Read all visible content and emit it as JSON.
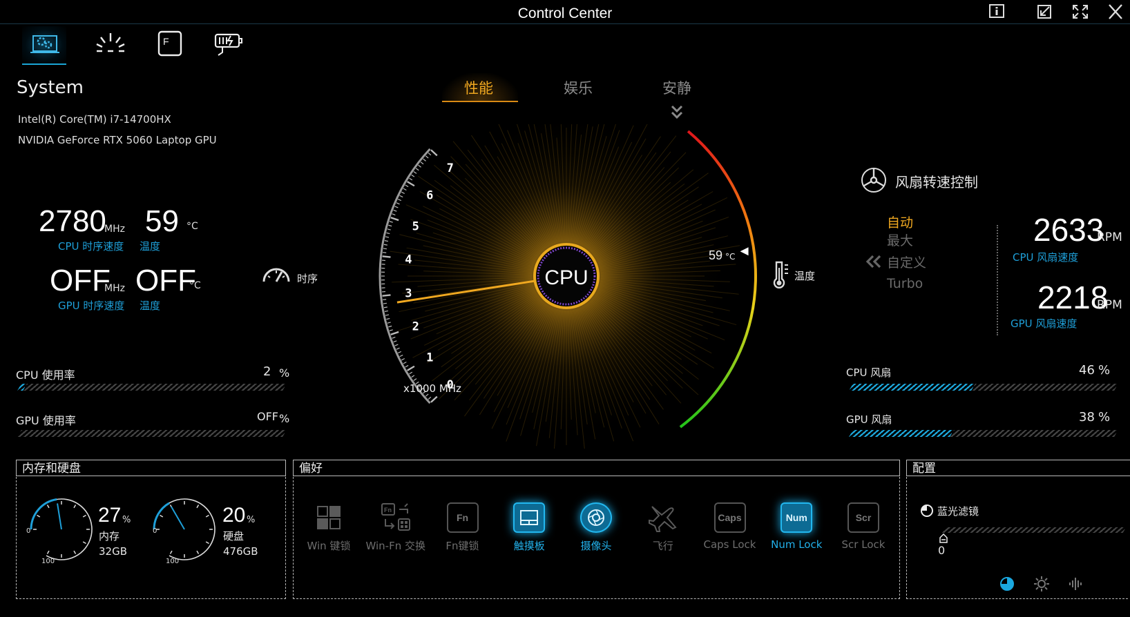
{
  "window": {
    "title": "Control Center"
  },
  "nav": {
    "tabs": [
      "system-settings",
      "lighting",
      "function-keys",
      "battery-power"
    ]
  },
  "system": {
    "heading": "System",
    "cpu_name": "Intel(R) Core(TM) i7-14700HX",
    "gpu_name": "NVIDIA GeForce RTX 5060 Laptop GPU",
    "cpu_clock": "2780",
    "cpu_clock_unit": "MHz",
    "cpu_clock_label": "CPU 时序速度",
    "cpu_temp": "59",
    "cpu_temp_unit": "°C",
    "cpu_temp_label": "温度",
    "gpu_clock": "OFF",
    "gpu_clock_unit": "MHz",
    "gpu_clock_label": "GPU 时序速度",
    "gpu_temp": "OFF",
    "gpu_temp_unit": "°C",
    "gpu_temp_label": "温度"
  },
  "usage": {
    "cpu_label": "CPU 使用率",
    "cpu_value": "2",
    "cpu_unit": "%",
    "cpu_percent": 2,
    "gpu_label": "GPU 使用率",
    "gpu_value": "OFF",
    "gpu_unit": "%",
    "gpu_percent": 0
  },
  "modes": {
    "items": [
      "性能",
      "娱乐",
      "安静"
    ],
    "selected": 0
  },
  "gauge": {
    "center_label": "CPU",
    "clock_side_label": "时序",
    "temp_side_label": "温度",
    "ticks": [
      "0",
      "1",
      "2",
      "3",
      "4",
      "5",
      "6",
      "7"
    ],
    "unit_label": "x1000 MHz",
    "clock_value_khz": 2.78,
    "temp_readout": "59",
    "temp_unit": "°C",
    "temp_value": 59
  },
  "fan": {
    "title": "风扇转速控制",
    "modes": [
      "自动",
      "最大",
      "自定义",
      "Turbo"
    ],
    "selected": 0,
    "cpu_rpm": "2633",
    "cpu_rpm_unit": "RPM",
    "cpu_rpm_label": "CPU 风扇速度",
    "gpu_rpm": "2218",
    "gpu_rpm_unit": "RPM",
    "gpu_rpm_label": "GPU 风扇速度",
    "cpu_fan_label": "CPU 风扇",
    "cpu_fan_value": "46",
    "cpu_fan_unit": "%",
    "cpu_fan_percent": 46,
    "gpu_fan_label": "GPU 风扇",
    "gpu_fan_value": "38",
    "gpu_fan_unit": "%",
    "gpu_fan_percent": 38
  },
  "memory": {
    "title": "内存和硬盘",
    "ram_percent": "27",
    "ram_percent_value": 27,
    "ram_pct_unit": "%",
    "ram_label": "内存",
    "ram_size": "32GB",
    "disk_percent": "20",
    "disk_percent_value": 20,
    "disk_pct_unit": "%",
    "disk_label": "硬盘",
    "disk_size": "476GB",
    "dial_min": "0",
    "dial_max": "100"
  },
  "preferences": {
    "title": "偏好",
    "items": [
      {
        "label": "Win 键锁",
        "icon_text": "",
        "on": false
      },
      {
        "label": "Win-Fn 交换",
        "icon_text": "",
        "on": false
      },
      {
        "label": "Fn键锁",
        "icon_text": "Fn",
        "on": false
      },
      {
        "label": "触摸板",
        "icon_text": "",
        "on": true
      },
      {
        "label": "摄像头",
        "icon_text": "",
        "on": true
      },
      {
        "label": "飞行",
        "icon_text": "",
        "on": false
      },
      {
        "label": "Caps Lock",
        "icon_text": "Caps",
        "on": false
      },
      {
        "label": "Num Lock",
        "icon_text": "Num",
        "on": true
      },
      {
        "label": "Scr Lock",
        "icon_text": "Scr",
        "on": false
      }
    ]
  },
  "config": {
    "title": "配置",
    "blue_filter_label": "蓝光滤镜",
    "blue_filter_value": "0",
    "blue_filter_percent": 0
  },
  "colors": {
    "accent": "#1e9fd8",
    "gold": "#f0a820",
    "purple": "#8a4bd6"
  }
}
